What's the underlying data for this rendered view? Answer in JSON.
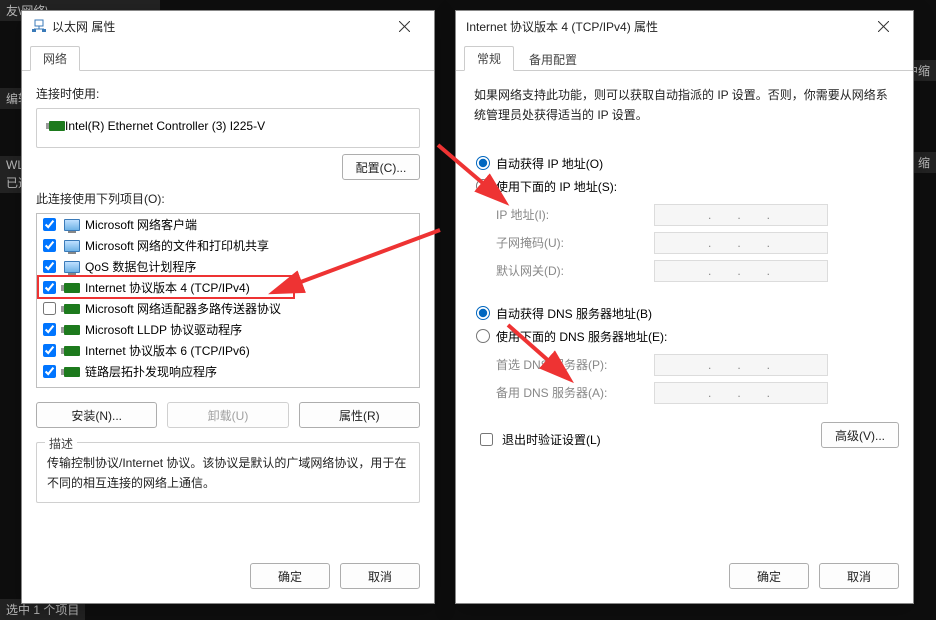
{
  "bg": {
    "top_path": "友\\网络\\",
    "edit": "编辑",
    "wifi": "WLA",
    "selected": "已选",
    "right_crumb": "中缩",
    "bottom_right": "缩",
    "bottom_left": "选中 1 个项目"
  },
  "dlg1": {
    "title": "以太网 属性",
    "tab": "网络",
    "connect_using": "连接时使用:",
    "adapter": "Intel(R) Ethernet Controller (3) I225-V",
    "configure_btn": "配置(C)...",
    "uses_label": "此连接使用下列项目(O):",
    "items": [
      {
        "checked": true,
        "icon": "mon",
        "label": "Microsoft 网络客户端"
      },
      {
        "checked": true,
        "icon": "mon",
        "label": "Microsoft 网络的文件和打印机共享"
      },
      {
        "checked": true,
        "icon": "mon",
        "label": "QoS 数据包计划程序"
      },
      {
        "checked": true,
        "icon": "nic",
        "label": "Internet 协议版本 4 (TCP/IPv4)"
      },
      {
        "checked": false,
        "icon": "nic",
        "label": "Microsoft 网络适配器多路传送器协议"
      },
      {
        "checked": true,
        "icon": "nic",
        "label": "Microsoft LLDP 协议驱动程序"
      },
      {
        "checked": true,
        "icon": "nic",
        "label": "Internet 协议版本 6 (TCP/IPv6)"
      },
      {
        "checked": true,
        "icon": "nic",
        "label": "链路层拓扑发现响应程序"
      }
    ],
    "install_btn": "安装(N)...",
    "uninstall_btn": "卸载(U)",
    "props_btn": "属性(R)",
    "desc_title": "描述",
    "desc_text": "传输控制协议/Internet 协议。该协议是默认的广域网络协议，用于在不同的相互连接的网络上通信。",
    "ok": "确定",
    "cancel": "取消"
  },
  "dlg2": {
    "title": "Internet 协议版本 4 (TCP/IPv4) 属性",
    "tab_general": "常规",
    "tab_alt": "备用配置",
    "intro": "如果网络支持此功能，则可以获取自动指派的 IP 设置。否则，你需要从网络系统管理员处获得适当的 IP 设置。",
    "r_auto_ip": "自动获得 IP 地址(O)",
    "r_manual_ip": "使用下面的 IP 地址(S):",
    "f_ip": "IP 地址(I):",
    "f_mask": "子网掩码(U):",
    "f_gw": "默认网关(D):",
    "r_auto_dns": "自动获得 DNS 服务器地址(B)",
    "r_manual_dns": "使用下面的 DNS 服务器地址(E):",
    "f_dns1": "首选 DNS 服务器(P):",
    "f_dns2": "备用 DNS 服务器(A):",
    "chk_validate": "退出时验证设置(L)",
    "adv_btn": "高级(V)...",
    "ok": "确定",
    "cancel": "取消"
  }
}
